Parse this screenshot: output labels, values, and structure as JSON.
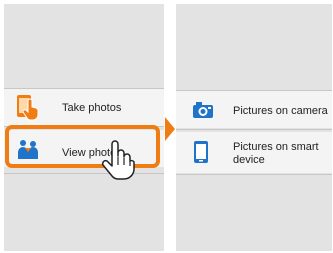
{
  "left_panel": {
    "items": [
      {
        "label": "Take photos",
        "icon": "take-photos-icon"
      },
      {
        "label": "View photos",
        "icon": "view-photos-icon"
      }
    ],
    "selected_index": 1
  },
  "right_panel": {
    "items": [
      {
        "label": "Pictures on camera",
        "icon": "camera-icon"
      },
      {
        "label": "Pictures on smart device",
        "icon": "smart-device-icon"
      }
    ]
  },
  "colors": {
    "panel_bg": "#e3e3e3",
    "row_bg": "#f4f4f4",
    "accent_orange": "#f07d14",
    "icon_blue": "#1f73c8"
  },
  "overlay_icons": [
    "pointing-hand-icon",
    "arrow-right-icon"
  ]
}
